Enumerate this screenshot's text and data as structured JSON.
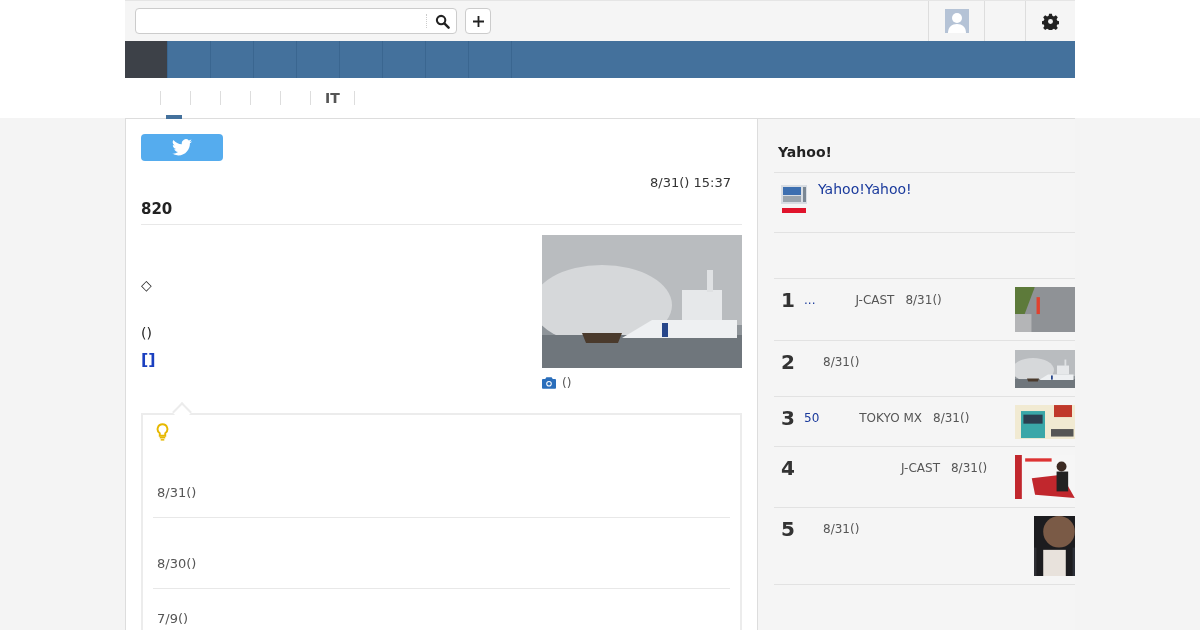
{
  "nav": {
    "items": [
      {
        "selected": true
      },
      {
        "selected": false
      },
      {
        "selected": false
      },
      {
        "selected": false
      },
      {
        "selected": false
      },
      {
        "selected": false
      },
      {
        "selected": false
      },
      {
        "selected": false
      },
      {
        "selected": false
      }
    ]
  },
  "tabs": [
    {
      "selected": true
    },
    {
      "selected": false
    },
    {
      "selected": false
    },
    {
      "selected": false
    },
    {
      "selected": false
    },
    {
      "label": "IT",
      "selected": false
    },
    {
      "selected": false
    }
  ],
  "article": {
    "date": "8/31() 15:37",
    "headline": "820",
    "paragraphs": [
      {
        "text": "◇",
        "kind": "plain"
      },
      {
        "text": "()",
        "kind": "plain"
      },
      {
        "text": "[]",
        "kind": "link"
      }
    ],
    "photo": {
      "kind": "picture",
      "caption": "()"
    }
  },
  "related": {
    "items": [
      {
        "date": "8/31()"
      },
      {
        "date": "8/30()"
      },
      {
        "date": "7/9()"
      }
    ]
  },
  "sidebar": {
    "title": "Yahoo!",
    "promo": "Yahoo!Yahoo!",
    "ranking": [
      {
        "rank": "1",
        "title": "...",
        "source": "J-CAST",
        "date": "8/31()"
      },
      {
        "rank": "2",
        "date": "8/31()"
      },
      {
        "rank": "3",
        "title": "50",
        "source": "TOKYO MX",
        "date": "8/31()"
      },
      {
        "rank": "4",
        "source": "J-CAST",
        "date": "8/31()"
      },
      {
        "rank": "5",
        "date": "8/31()"
      }
    ]
  }
}
